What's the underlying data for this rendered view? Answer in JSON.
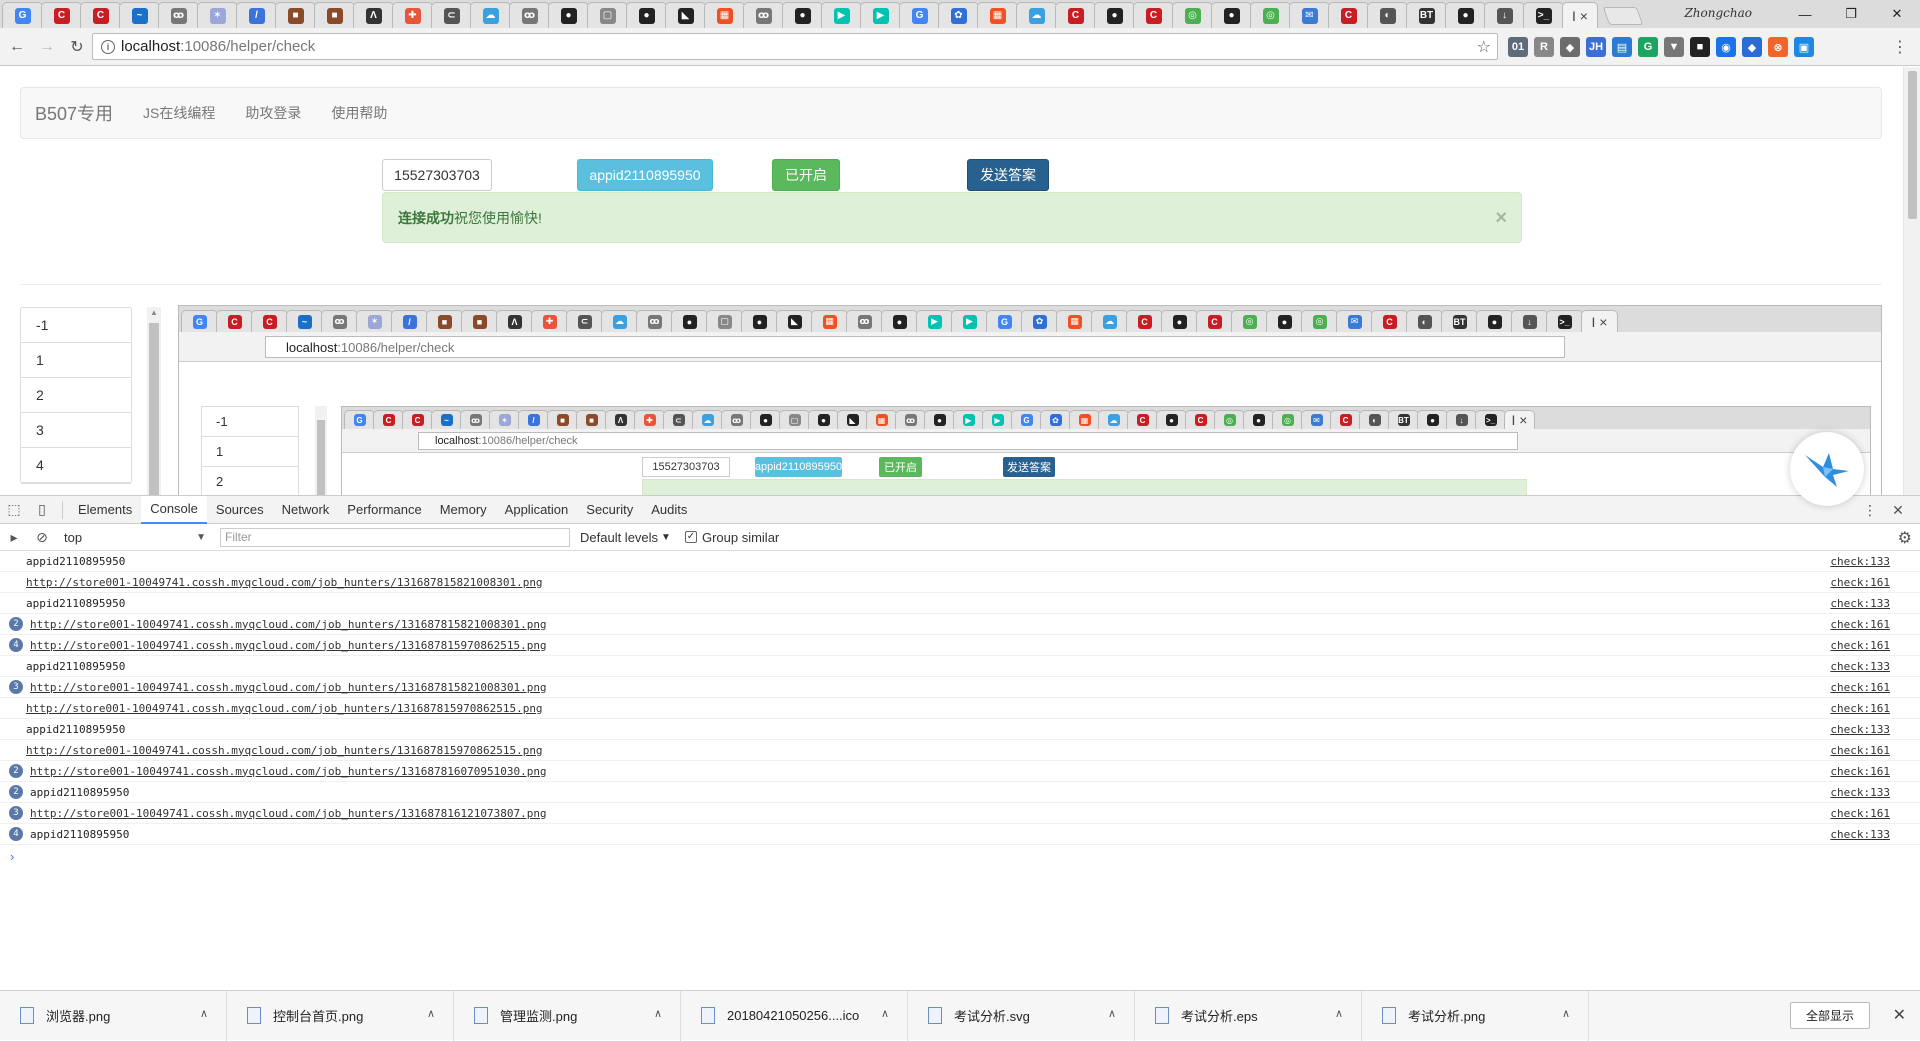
{
  "browser": {
    "profile": "Zhongchao",
    "url_host": "localhost",
    "url_path": ":10086/helper/check",
    "tab_icons": [
      {
        "glyph": "G",
        "color": "#4285f4"
      },
      {
        "glyph": "C",
        "color": "#c81d23"
      },
      {
        "glyph": "C",
        "color": "#c81d23"
      },
      {
        "glyph": "~",
        "color": "#1a6fc9"
      },
      {
        "glyph": "ꝏ",
        "color": "#777"
      },
      {
        "glyph": "✶",
        "color": "#9aa7d8"
      },
      {
        "glyph": "/",
        "color": "#3c73d9"
      },
      {
        "glyph": "■",
        "color": "#8b4a2a"
      },
      {
        "glyph": "■",
        "color": "#8b4a2a"
      },
      {
        "glyph": "Λ",
        "color": "#333"
      },
      {
        "glyph": "✚",
        "color": "#e8553a"
      },
      {
        "glyph": "⊂",
        "color": "#555"
      },
      {
        "glyph": "☁",
        "color": "#3aa0e0"
      },
      {
        "glyph": "ꝏ",
        "color": "#777"
      },
      {
        "glyph": "●",
        "color": "#222"
      },
      {
        "glyph": "▢",
        "color": "#888"
      },
      {
        "glyph": "●",
        "color": "#222"
      },
      {
        "glyph": "◣",
        "color": "#222"
      },
      {
        "glyph": "▦",
        "color": "#f25022"
      },
      {
        "glyph": "ꝏ",
        "color": "#777"
      },
      {
        "glyph": "●",
        "color": "#222"
      },
      {
        "glyph": "▶",
        "color": "#00c3b1"
      },
      {
        "glyph": "▶",
        "color": "#00c3b1"
      },
      {
        "glyph": "G",
        "color": "#4285f4"
      },
      {
        "glyph": "✿",
        "color": "#2f6fd8"
      },
      {
        "glyph": "▦",
        "color": "#f25022"
      },
      {
        "glyph": "☁",
        "color": "#3aa0e0"
      },
      {
        "glyph": "C",
        "color": "#c81d23"
      },
      {
        "glyph": "●",
        "color": "#222"
      },
      {
        "glyph": "C",
        "color": "#c81d23"
      },
      {
        "glyph": "◎",
        "color": "#4caf50"
      },
      {
        "glyph": "●",
        "color": "#222"
      },
      {
        "glyph": "◎",
        "color": "#4caf50"
      },
      {
        "glyph": "✉",
        "color": "#3a7bd5"
      },
      {
        "glyph": "C",
        "color": "#c81d23"
      },
      {
        "glyph": "◐",
        "color": "#555"
      },
      {
        "glyph": "BT",
        "color": "#333"
      },
      {
        "glyph": "●",
        "color": "#222"
      },
      {
        "glyph": "↓",
        "color": "#555"
      },
      {
        "glyph": ">_",
        "color": "#222"
      }
    ],
    "active_tab_label": "I",
    "window_controls": [
      "—",
      "❐",
      "✕"
    ],
    "extensions": [
      {
        "glyph": "01",
        "color": "#5d6b7a"
      },
      {
        "glyph": "R",
        "color": "#888"
      },
      {
        "glyph": "◆",
        "color": "#6c6c6c"
      },
      {
        "glyph": "JH",
        "color": "#3b6fd6"
      },
      {
        "glyph": "▤",
        "color": "#2b7bd4"
      },
      {
        "glyph": "G",
        "color": "#1da462"
      },
      {
        "glyph": "▼",
        "color": "#777"
      },
      {
        "glyph": "■",
        "color": "#222"
      },
      {
        "glyph": "◉",
        "color": "#1a73e8"
      },
      {
        "glyph": "◆",
        "color": "#2b6cd4"
      },
      {
        "glyph": "⊗",
        "color": "#f06529"
      },
      {
        "glyph": "▣",
        "color": "#1e88e5"
      }
    ]
  },
  "page": {
    "brand": "B507专用",
    "nav_links": [
      "JS在线编程",
      "助攻登录",
      "使用帮助"
    ],
    "phone_value": "15527303703",
    "appid_button": "appid2110895950",
    "status_button": "已开启",
    "send_button": "发送答案",
    "alert_strong": "连接成功",
    "alert_text": "祝您使用愉快!",
    "alert_close": "×",
    "list_items": [
      "-1",
      "1",
      "2",
      "3",
      "4"
    ],
    "nested_list_items": [
      "-1",
      "1",
      "2"
    ]
  },
  "devtools": {
    "tabs": [
      "Elements",
      "Console",
      "Sources",
      "Network",
      "Performance",
      "Memory",
      "Application",
      "Security",
      "Audits"
    ],
    "active_tab": "Console",
    "context": "top",
    "filter_placeholder": "Filter",
    "levels_label": "Default levels",
    "group_similar_label": "Group similar",
    "group_similar_checked": true,
    "messages": [
      {
        "text": "appid2110895950",
        "link": false,
        "count": "",
        "source": "check:133"
      },
      {
        "text": "http://store001-10049741.cossh.myqcloud.com/job_hunters/1316878158210083​01.png",
        "link": true,
        "count": "",
        "source": "check:161"
      },
      {
        "text": "appid2110895950",
        "link": false,
        "count": "",
        "source": "check:133"
      },
      {
        "text": "http://store001-10049741.cossh.myqcloud.com/job_hunters/131687815821008301.png",
        "link": true,
        "count": "2",
        "source": "check:161"
      },
      {
        "text": "http://store001-10049741.cossh.myqcloud.com/job_hunters/131687815970862515.png",
        "link": true,
        "count": "4",
        "source": "check:161"
      },
      {
        "text": "appid2110895950",
        "link": false,
        "count": "",
        "source": "check:133"
      },
      {
        "text": "http://store001-10049741.cossh.myqcloud.com/job_hunters/131687815821008301.png",
        "link": true,
        "count": "3",
        "source": "check:161"
      },
      {
        "text": "http://store001-10049741.cossh.myqcloud.com/job_hunters/131687815970862515.png",
        "link": true,
        "count": "",
        "source": "check:161"
      },
      {
        "text": "appid2110895950",
        "link": false,
        "count": "",
        "source": "check:133"
      },
      {
        "text": "http://store001-10049741.cossh.myqcloud.com/job_hunters/131687815970862515.png",
        "link": true,
        "count": "",
        "source": "check:161"
      },
      {
        "text": "http://store001-10049741.cossh.myqcloud.com/job_hunters/131687816070951030.png",
        "link": true,
        "count": "2",
        "source": "check:161"
      },
      {
        "text": "appid2110895950",
        "link": false,
        "count": "2",
        "source": "check:133"
      },
      {
        "text": "http://store001-10049741.cossh.myqcloud.com/job_hunters/131687816121073807.png",
        "link": true,
        "count": "3",
        "source": "check:161"
      },
      {
        "text": "appid2110895950",
        "link": false,
        "count": "4",
        "source": "check:133"
      }
    ],
    "prompt": "›"
  },
  "downloads": {
    "items": [
      {
        "name": "浏览器.png"
      },
      {
        "name": "控制台首页.png"
      },
      {
        "name": "管理监测.png"
      },
      {
        "name": "20180421050256....ico"
      },
      {
        "name": "考试分析.svg"
      },
      {
        "name": "考试分析.eps"
      },
      {
        "name": "考试分析.png"
      }
    ],
    "show_all": "全部显示"
  }
}
